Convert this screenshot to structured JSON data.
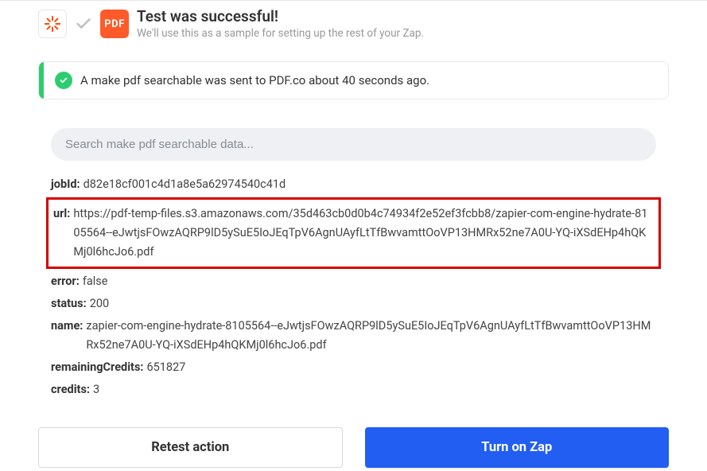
{
  "header": {
    "title": "Test was successful!",
    "subtitle": "We'll use this as a sample for setting up the rest of your Zap.",
    "pdf_icon_label": "PDF"
  },
  "callout": {
    "text": "A make pdf searchable was sent to PDF.co about 40 seconds ago."
  },
  "search": {
    "placeholder": "Search make pdf searchable data..."
  },
  "results": {
    "jobId": {
      "key": "jobId:",
      "value": "d82e18cf001c4d1a8e5a62974540c41d"
    },
    "url": {
      "key": "url:",
      "value": "https://pdf-temp-files.s3.amazonaws.com/35d463cb0d0b4c74934f2e52ef3fcbb8/zapier-com-engine-hydrate-8105564--eJwtjsFOwzAQRP9lD5ySuE5IoJEqTpV6AgnUAyfLtTfBwvamttOoVP13HMRx52ne7A0U-YQ-iXSdEHp4hQKMj0l6hcJo6.pdf"
    },
    "error": {
      "key": "error:",
      "value": "false"
    },
    "status": {
      "key": "status:",
      "value": "200"
    },
    "name": {
      "key": "name:",
      "value": "zapier-com-engine-hydrate-8105564--eJwtjsFOwzAQRP9lD5ySuE5IoJEqTpV6AgnUAyfLtTfBwvamttOoVP13HMRx52ne7A0U-YQ-iXSdEHp4hQKMj0l6hcJo6.pdf"
    },
    "remainingCredits": {
      "key": "remainingCredits:",
      "value": "651827"
    },
    "credits": {
      "key": "credits:",
      "value": "3"
    }
  },
  "footer": {
    "retest_label": "Retest action",
    "turn_on_label": "Turn on Zap"
  }
}
